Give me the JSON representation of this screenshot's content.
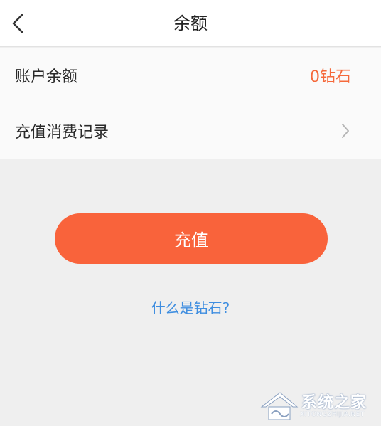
{
  "navbar": {
    "title": "余额",
    "back_icon": "chevron-left-icon"
  },
  "list": {
    "balance_label": "账户余额",
    "balance_value": "0钻石",
    "records_label": "充值消费记录",
    "records_icon": "chevron-right-icon"
  },
  "actions": {
    "recharge_label": "充值",
    "help_link": "什么是钻石?"
  },
  "watermark": {
    "text": "系统之家",
    "sub": "XITONGZHIJIA.NET"
  },
  "colors": {
    "accent": "#f9633b",
    "value_text": "#f5693b",
    "link": "#3f8ee0",
    "background": "#efefef"
  }
}
